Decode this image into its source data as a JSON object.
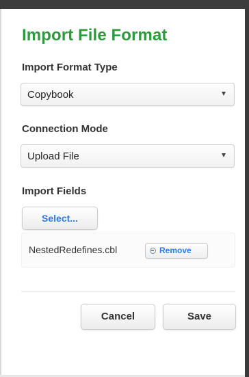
{
  "dialog": {
    "title": "Import File Format"
  },
  "format_type": {
    "label": "Import Format Type",
    "selected": "Copybook"
  },
  "connection_mode": {
    "label": "Connection Mode",
    "selected": "Upload File"
  },
  "import_fields": {
    "label": "Import Fields",
    "select_button": "Select...",
    "file_name": "NestedRedefines.cbl",
    "remove_button": "Remove"
  },
  "footer": {
    "cancel_label": "Cancel",
    "save_label": "Save"
  },
  "colors": {
    "title_green": "#2f9a3c",
    "link_blue": "#2a7be4",
    "label_text": "#333333"
  },
  "icons": {
    "dropdown": "chevron-down-icon",
    "remove": "remove-circle-icon"
  }
}
